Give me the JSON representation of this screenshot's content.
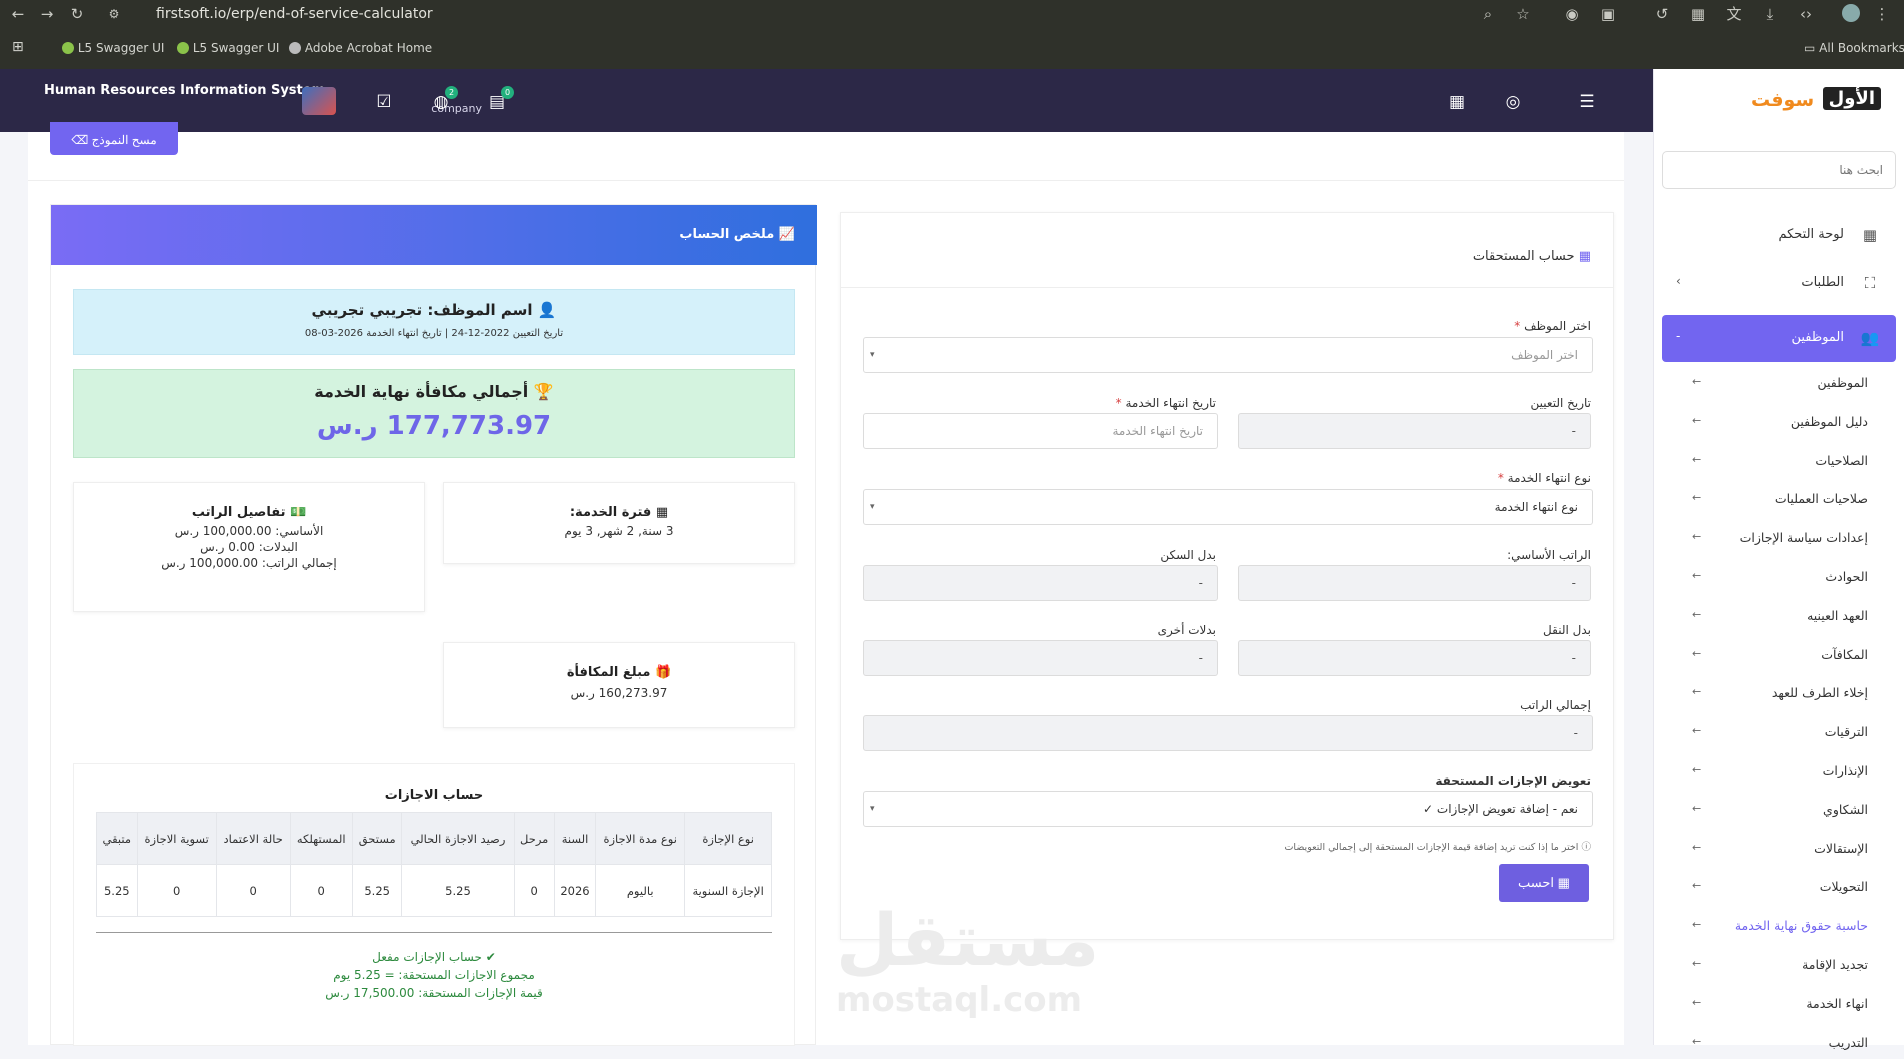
{
  "browser": {
    "url": "firstsoft.io/erp/end-of-service-calculator",
    "bookmarks": [
      "L5 Swagger UI",
      "L5 Swagger UI",
      "Adobe Acrobat Home"
    ],
    "all_bookmarks": "All Bookmarks"
  },
  "header": {
    "title": "Human Resources Information System",
    "subtitle": "company",
    "badges": {
      "globe": "2",
      "chat": "0"
    }
  },
  "sidebar": {
    "logo_latin": "الأول",
    "logo_brand": "سوفت",
    "search_placeholder": "ابحث هنا",
    "items": [
      {
        "label": "لوحة التحكم",
        "icon": "dashboard-icon"
      },
      {
        "label": "الطلبات",
        "icon": "requests-icon",
        "chevron": "›"
      },
      {
        "label": "الموظفين",
        "icon": "users-icon",
        "chevron": "-"
      }
    ],
    "subitems": [
      "الموظفين",
      "دليل الموظفين",
      "الصلاحيات",
      "صلاحيات العمليات",
      "إعدادات سياسة الإجازات",
      "الحوادث",
      "العهد العينيه",
      "المكافآت",
      "إخلاء الطرف للعهد",
      "الترقيات",
      "الإنذارات",
      "الشكاوي",
      "الإستقالات",
      "التحويلات",
      "حاسبة حقوق نهاية الخدمة",
      "تجديد الإقامة",
      "انهاء الخدمة",
      "التدريب"
    ],
    "current_subitem": 14
  },
  "main": {
    "reset_button": "مسح النموذج"
  },
  "summary": {
    "title": "ملخص الحساب",
    "employee_line": "اسم الموظف: تجريبي تجريبي",
    "dates_line": "تاريخ التعيين 2022-12-24 | تاريخ انتهاء الخدمة 2026-03-08",
    "total_label": "أجمالي مكافأة نهاية الخدمة",
    "total_value": "177,773.97 ر.س",
    "service": {
      "title": "فترة الخدمة:",
      "value": "3 سنة, 2 شهر, 3 يوم"
    },
    "salary": {
      "title": "تفاصيل الراتب",
      "basic": "الأساسي: 100,000.00 ر.س",
      "allowances": "البدلات: 0.00 ر.س",
      "total": "إجمالي الراتب: 100,000.00 ر.س"
    },
    "reward": {
      "title": "مبلغ المكافأة",
      "value": "160,273.97 ر.س"
    }
  },
  "leave": {
    "caption": "حساب الاجازات",
    "headers": [
      "نوع الإجازة",
      "نوع مدة الاجازة",
      "السنة",
      "مرحل",
      "رصيد الاجازة الحالي",
      "مستحق",
      "المستهلكه",
      "حالة الاعتماد",
      "تسوية الاجازة",
      "متبقي"
    ],
    "rows": [
      [
        "الإجازة السنوية",
        "باليوم",
        "2026",
        "0",
        "5.25",
        "5.25",
        "0",
        "0",
        "0",
        "5.25"
      ]
    ],
    "status_enabled": "حساب الإجازات مفعل",
    "status_days": "مجموع الاجازات المستحقة: = 5.25 يوم",
    "status_value": "قيمة الإجازات المستحقة: 17,500.00 ر.س"
  },
  "form": {
    "title": "حساب المستحقات",
    "employee_label": "اختر الموظف",
    "employee_placeholder": "اختر الموظف",
    "hire_date_label": "تاريخ التعيين",
    "hire_date_value": "-",
    "end_date_label": "تاريخ انتهاء الخدمة",
    "end_date_placeholder": "تاريخ انتهاء الخدمة",
    "end_type_label": "نوع انتهاء الخدمة",
    "end_type_value": "نوع انتهاء الخدمة",
    "basic_label": "الراتب الأساسي:",
    "basic_value": "-",
    "housing_label": "بدل السكن",
    "housing_value": "-",
    "transport_label": "بدل النقل",
    "transport_value": "-",
    "other_label": "بدلات أخرى",
    "other_value": "-",
    "total_label": "إجمالي الراتب",
    "total_value": "-",
    "leave_comp_label": "تعويض الإجازات المستحقة",
    "leave_comp_value": "نعم - إضافة تعويض الإجازات ✓",
    "hint": "اختر ما إذا كنت تريد إضافة قيمة الإجازات المستحقة إلى إجمالي التعويضات",
    "calc_button": "احسب",
    "required_mark": "*"
  },
  "watermark": {
    "ar": "مستقل",
    "en": "mostaql.com"
  },
  "colors": {
    "primary": "#7265f0",
    "header": "#2c2847",
    "success": "#2d8a3e",
    "total": "#6e66e8"
  }
}
